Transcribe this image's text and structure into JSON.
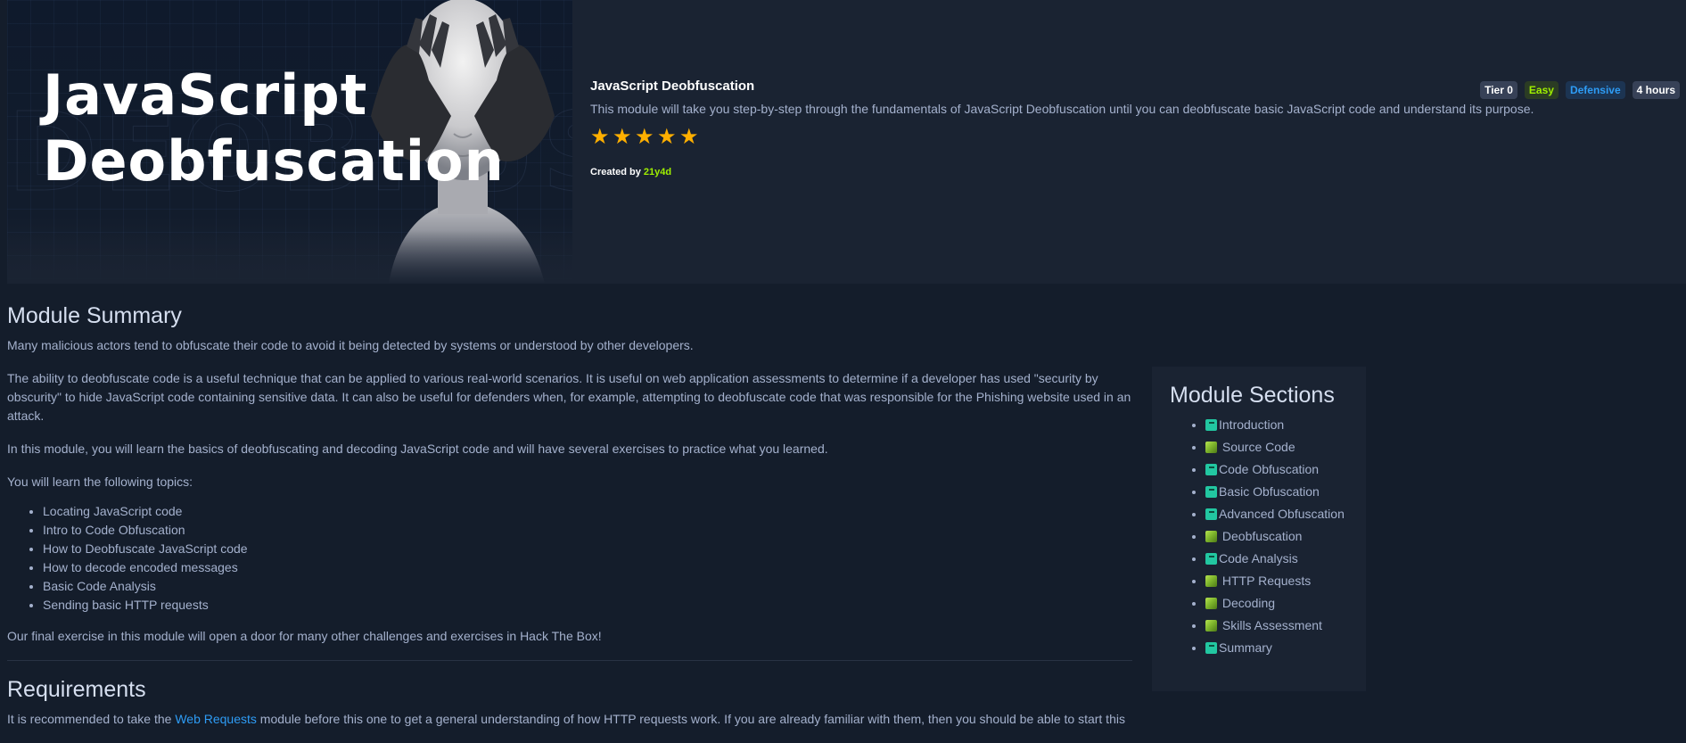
{
  "banner": {
    "title_line1": "JavaScript",
    "title_line2": "Deobfuscation"
  },
  "module": {
    "name": "JavaScript Deobfuscation",
    "description": "This module will take you step-by-step through the fundamentals of JavaScript Deobfuscation until you can deobfuscate basic JavaScript code and understand its purpose.",
    "rating_stars": 5,
    "created_by_label": "Created by",
    "author": "21y4d",
    "badges": {
      "tier": "Tier 0",
      "difficulty": "Easy",
      "category": "Defensive",
      "duration": "4 hours"
    }
  },
  "summary": {
    "heading": "Module Summary",
    "p1": "Many malicious actors tend to obfuscate their code to avoid it being detected by systems or understood by other developers.",
    "p2": "The ability to deobfuscate code is a useful technique that can be applied to various real-world scenarios. It is useful on web application assessments to determine if a developer has used \"security by obscurity\" to hide JavaScript code containing sensitive data. It can also be useful for defenders when, for example, attempting to deobfuscate code that was responsible for the Phishing website used in an attack.",
    "p3": "In this module, you will learn the basics of deobfuscating and decoding JavaScript code and will have several exercises to practice what you learned.",
    "p4": "You will learn the following topics:",
    "topics": [
      "Locating JavaScript code",
      "Intro to Code Obfuscation",
      "How to Deobfuscate JavaScript code",
      "How to decode encoded messages",
      "Basic Code Analysis",
      "Sending basic HTTP requests"
    ],
    "p5": "Our final exercise in this module will open a door for many other challenges and exercises in Hack The Box!"
  },
  "requirements": {
    "heading": "Requirements",
    "text_before": "It is recommended to take the ",
    "link": "Web Requests",
    "text_after": " module before this one to get a general understanding of how HTTP requests work. If you are already familiar with them, then you should be able to start this"
  },
  "sections": {
    "heading": "Module Sections",
    "items": [
      {
        "label": "Introduction",
        "icon": "book-icon"
      },
      {
        "label": "Source Code",
        "icon": "cube-icon"
      },
      {
        "label": "Code Obfuscation",
        "icon": "book-icon"
      },
      {
        "label": "Basic Obfuscation",
        "icon": "book-icon"
      },
      {
        "label": "Advanced Obfuscation",
        "icon": "book-icon"
      },
      {
        "label": "Deobfuscation",
        "icon": "cube-icon"
      },
      {
        "label": "Code Analysis",
        "icon": "book-icon"
      },
      {
        "label": "HTTP Requests",
        "icon": "cube-icon"
      },
      {
        "label": "Decoding",
        "icon": "cube-icon"
      },
      {
        "label": "Skills Assessment",
        "icon": "cube-icon"
      },
      {
        "label": "Summary",
        "icon": "book-icon"
      }
    ]
  },
  "colors": {
    "background": "#141d2b",
    "card": "#1a2332",
    "accent_green": "#9fef00",
    "accent_blue": "#2e9cf5",
    "star": "#ffaf00"
  }
}
